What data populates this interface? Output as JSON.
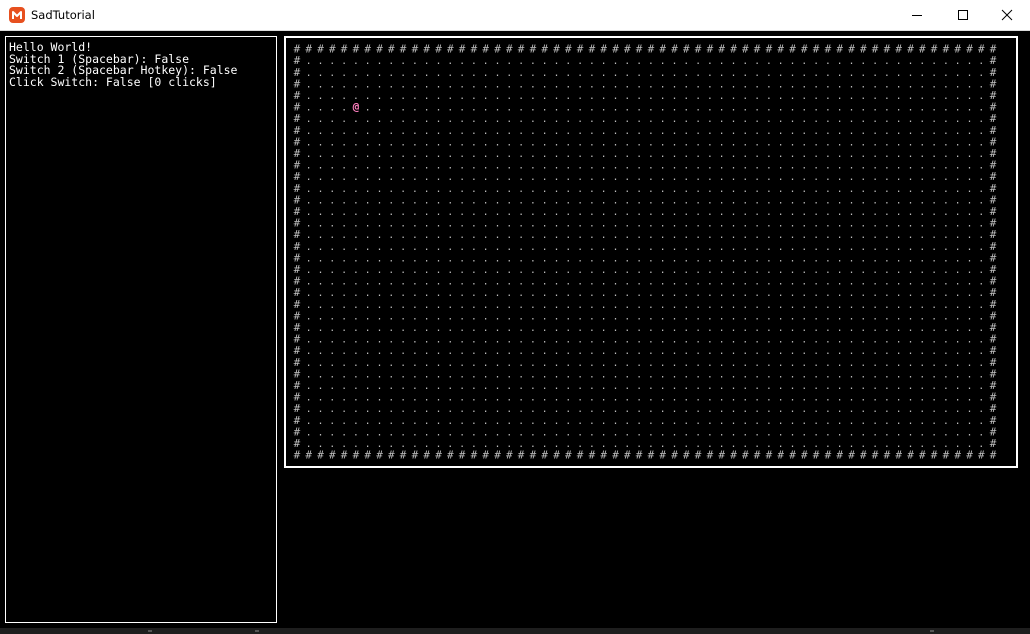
{
  "window": {
    "title": "SadTutorial",
    "icon": "monogame-logo-icon",
    "controls": {
      "minimize": "minimize-icon",
      "maximize": "maximize-icon",
      "close": "close-icon"
    }
  },
  "status": {
    "lines": [
      "Hello World!",
      "Switch 1 (Spacebar): False",
      "Switch 2 (Spacebar Hotkey): False",
      "Click Switch: False [0 clicks]"
    ]
  },
  "map": {
    "cols": 60,
    "rows": 36,
    "wall_glyph": "#",
    "floor_glyph": ".",
    "player_glyph": "@",
    "player_col": 5,
    "player_row": 5,
    "colors": {
      "wall": "#bfbfbf",
      "floor": "#bfbfbf",
      "player": "#ff7fbf",
      "background": "#000000",
      "border": "#ffffff"
    }
  }
}
